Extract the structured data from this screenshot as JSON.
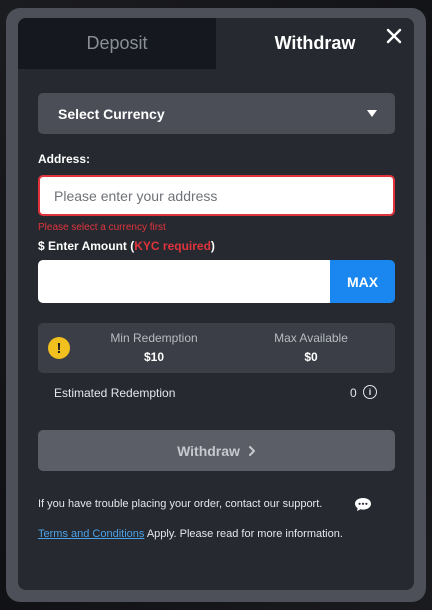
{
  "tabs": {
    "deposit": "Deposit",
    "withdraw": "Withdraw",
    "active": "Withdraw"
  },
  "currency_select": {
    "label": "Select Currency"
  },
  "address": {
    "label": "Address:",
    "placeholder": "Please enter your address",
    "value": "",
    "error": "Please select a currency first"
  },
  "amount": {
    "label_prefix": "$ Enter Amount (",
    "kyc": "KYC required",
    "label_suffix": ")",
    "value": "",
    "max_label": "MAX"
  },
  "limits": {
    "min_label": "Min Redemption",
    "min_value": "$10",
    "max_label": "Max Available",
    "max_value": "$0"
  },
  "estimate": {
    "label": "Estimated Redemption",
    "value": "0"
  },
  "withdraw_button": {
    "label": "Withdraw"
  },
  "support": {
    "text": "If you have trouble placing your order, contact our support."
  },
  "terms": {
    "link": "Terms and Conditions",
    "rest": " Apply. Please read for more information."
  },
  "icons": {
    "close": "close-icon",
    "caret": "chevron-down-icon",
    "warning": "warning-icon",
    "info": "info-icon",
    "chevron": "chevron-right-icon",
    "chat": "chat-bubble-icon"
  },
  "colors": {
    "error": "#e0343c",
    "accent": "#1a86f0",
    "warning": "#f2c01e",
    "link": "#4ba2e8"
  }
}
